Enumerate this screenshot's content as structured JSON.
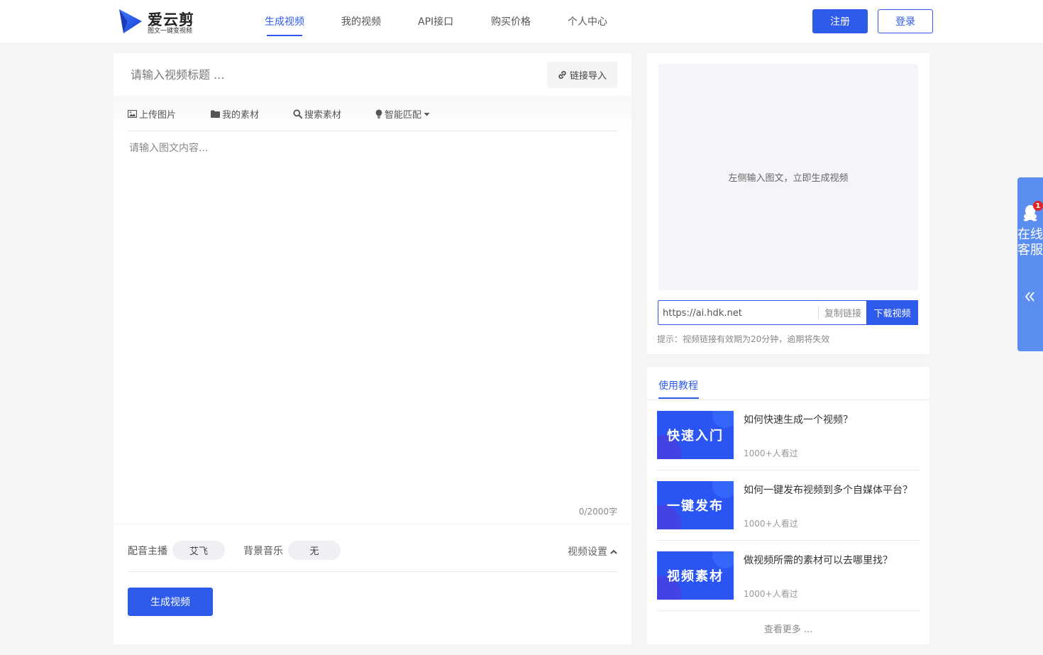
{
  "brand": {
    "name": "爱云剪",
    "tagline": "图文一键变视频",
    "color": "#2f5bea"
  },
  "nav": {
    "items": [
      "生成视频",
      "我的视频",
      "API接口",
      "购买价格",
      "个人中心"
    ],
    "active": 0
  },
  "auth": {
    "register": "注册",
    "login": "登录"
  },
  "editor": {
    "title_placeholder": "请输入视频标题 ...",
    "link_import": "链接导入",
    "tools": {
      "upload_image": "上传图片",
      "my_materials": "我的素材",
      "search_materials": "搜索素材",
      "smart_match": "智能匹配"
    },
    "content_placeholder": "请输入图文内容...",
    "char_count": "0/2000字",
    "voice_label": "配音主播",
    "voice_value": "艾飞",
    "music_label": "背景音乐",
    "music_value": "无",
    "video_settings": "视频设置",
    "generate": "生成视频"
  },
  "preview": {
    "placeholder": "左侧输入图文，立即生成视频",
    "url": "https://ai.hdk.net",
    "copy_link": "复制链接",
    "download": "下载视频",
    "hint": "提示：视频链接有效期为20分钟，逾期将失效"
  },
  "tutorial": {
    "tab": "使用教程",
    "items": [
      {
        "thumb_text": "快速入门",
        "title": "如何快速生成一个视频？",
        "views": "1000+人看过"
      },
      {
        "thumb_text": "一键发布",
        "title": "如何一键发布视频到多个自媒体平台？",
        "views": "1000+人看过"
      },
      {
        "thumb_text": "视频素材",
        "title": "做视频所需的素材可以去哪里找？",
        "views": "1000+人看过"
      }
    ],
    "see_more": "查看更多 ..."
  },
  "service": {
    "label": "在线客服",
    "badge": "1"
  }
}
